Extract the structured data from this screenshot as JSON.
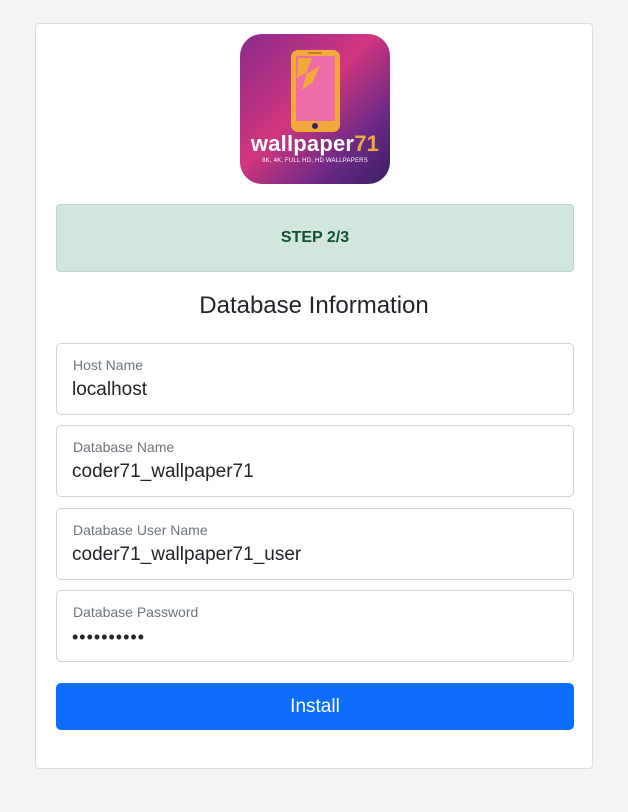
{
  "logo": {
    "brand_main": "wallpaper",
    "brand_accent": "71",
    "tagline": "8K, 4K, FULL HD, HD WALLPAPERS",
    "icon": "phone-lightning-icon"
  },
  "step": {
    "label": "STEP 2/3"
  },
  "heading": "Database Information",
  "fields": {
    "host": {
      "label": "Host Name",
      "value": "localhost"
    },
    "db_name": {
      "label": "Database Name",
      "value": "coder71_wallpaper71"
    },
    "db_user": {
      "label": "Database User Name",
      "value": "coder71_wallpaper71_user"
    },
    "db_password": {
      "label": "Database Password",
      "value": "••••••••••"
    }
  },
  "install_button": {
    "label": "Install"
  },
  "colors": {
    "primary": "#0d6efd",
    "success_bg": "#d1e7dd",
    "success_text": "#0f5132",
    "brand_accent": "#f2a93b"
  }
}
